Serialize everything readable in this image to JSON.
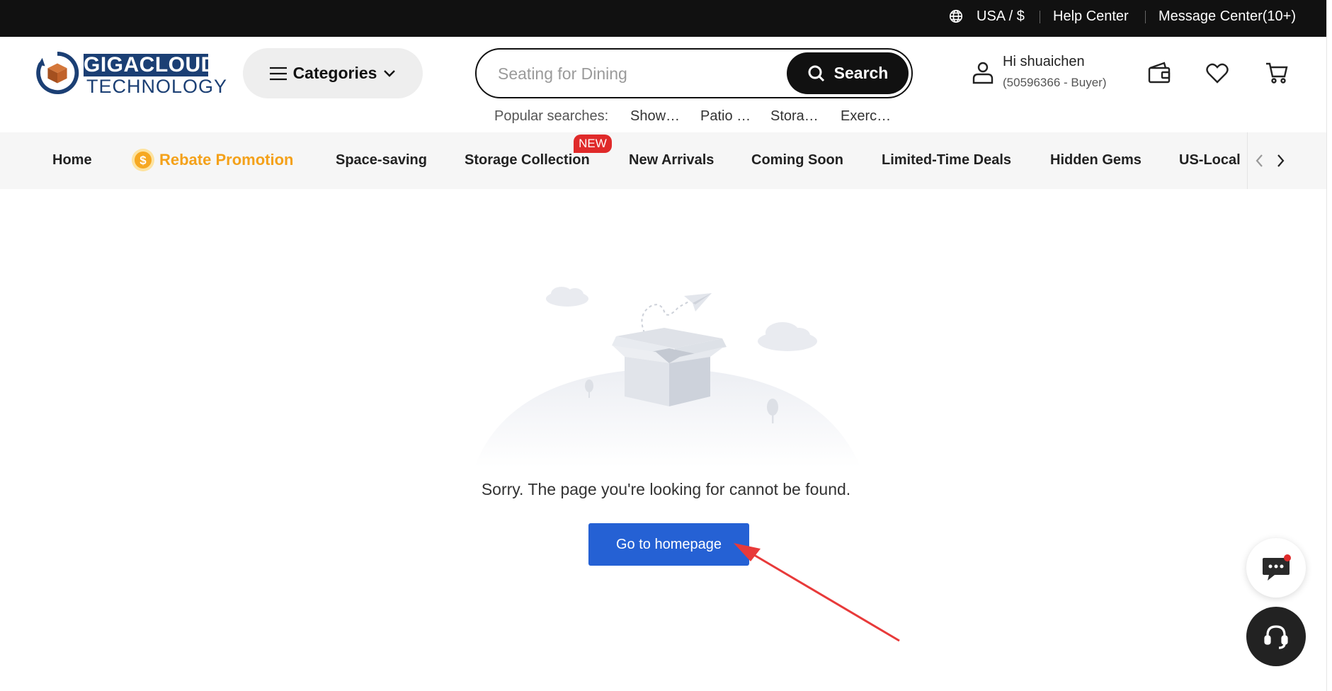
{
  "topbar": {
    "region": "USA / $",
    "help": "Help Center",
    "messages": "Message Center(10+)"
  },
  "logo": {
    "top": "GIGACLOUD",
    "bottom": "TECHNOLOGY"
  },
  "header": {
    "categories_label": "Categories",
    "search_placeholder": "Seating for Dining",
    "search_button": "Search",
    "popular_label": "Popular searches:",
    "popular_items": [
      "Show…",
      "Patio …",
      "Stora…",
      "Exerc…"
    ],
    "user_greeting": "Hi shuaichen",
    "user_id": "(50596366 - Buyer)"
  },
  "nav": {
    "items": [
      "Home",
      "Rebate Promotion",
      "Space-saving",
      "Storage Collection",
      "New Arrivals",
      "Coming Soon",
      "Limited-Time Deals",
      "Hidden Gems",
      "US-Local"
    ],
    "new_badge": "NEW"
  },
  "main": {
    "message": "Sorry. The page you're looking for cannot be found.",
    "button": "Go to homepage"
  },
  "colors": {
    "accent": "#2561d4",
    "rebate": "#f4a11a",
    "badge": "#e02a2a",
    "annotation_arrow": "#e83a3a"
  }
}
